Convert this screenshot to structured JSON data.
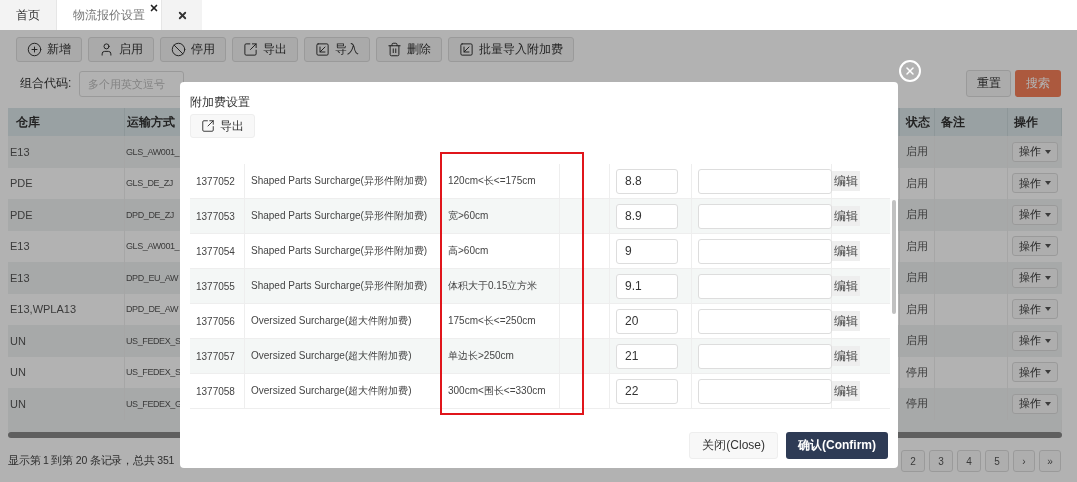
{
  "tabs": [
    {
      "label": "首页",
      "selected": false,
      "closable": false
    },
    {
      "label": "物流报价设置",
      "selected": true,
      "closable": true
    }
  ],
  "toolbar": [
    {
      "label": "新增",
      "kind": "add"
    },
    {
      "label": "启用",
      "kind": "enable"
    },
    {
      "label": "停用",
      "kind": "disable"
    },
    {
      "label": "导出",
      "kind": "export"
    },
    {
      "label": "导入",
      "kind": "import"
    },
    {
      "label": "删除",
      "kind": "delete"
    },
    {
      "label": "批量导入附加费",
      "kind": "import"
    }
  ],
  "filter": {
    "label": "组合代码:",
    "placeholder": "多个用英文逗号"
  },
  "reset_button": "重置",
  "search_button": "搜索",
  "table": {
    "columns": [
      "仓库",
      "运输方式",
      "状态",
      "备注",
      "操作"
    ],
    "rows": [
      {
        "warehouse": "E13",
        "shipping": "GLS_AW001_",
        "status": "启用",
        "action": "操作"
      },
      {
        "warehouse": "PDE",
        "shipping": "GLS_DE_ZJ",
        "status": "启用",
        "action": "操作"
      },
      {
        "warehouse": "PDE",
        "shipping": "DPD_DE_ZJ",
        "status": "启用",
        "action": "操作"
      },
      {
        "warehouse": "E13",
        "shipping": "GLS_AW001_",
        "status": "启用",
        "action": "操作"
      },
      {
        "warehouse": "E13",
        "shipping": "DPD_EU_AW",
        "status": "启用",
        "action": "操作"
      },
      {
        "warehouse": "E13,WPLA13",
        "shipping": "DPD_DE_AW",
        "status": "启用",
        "action": "操作"
      },
      {
        "warehouse": "UN",
        "shipping": "US_FEDEX_S",
        "status": "启用",
        "action": "操作"
      },
      {
        "warehouse": "UN",
        "shipping": "US_FEDEX_S",
        "status": "停用",
        "action": "操作"
      },
      {
        "warehouse": "UN",
        "shipping": "US_FEDEX_G",
        "status": "停用",
        "action": "操作"
      }
    ]
  },
  "pagination": {
    "summary": "显示第 1 到第 20 条记录，总共 351",
    "pages": [
      "2",
      "3",
      "4",
      "5",
      "›",
      "»"
    ]
  },
  "dialog": {
    "title": "附加费设置",
    "export_button": "导出",
    "rows": [
      {
        "id": "1377052",
        "name": "Shaped Parts Surcharge(异形件附加费)",
        "condition": "120cm<长<=175cm",
        "value": "8.8",
        "edit": "编辑"
      },
      {
        "id": "1377053",
        "name": "Shaped Parts Surcharge(异形件附加费)",
        "condition": "宽>60cm",
        "value": "8.9",
        "edit": "编辑"
      },
      {
        "id": "1377054",
        "name": "Shaped Parts Surcharge(异形件附加费)",
        "condition": "高>60cm",
        "value": "9",
        "edit": "编辑"
      },
      {
        "id": "1377055",
        "name": "Shaped Parts Surcharge(异形件附加费)",
        "condition": "体积大于0.15立方米",
        "value": "9.1",
        "edit": "编辑"
      },
      {
        "id": "1377056",
        "name": "Oversized Surcharge(超大件附加费)",
        "condition": "175cm<长<=250cm",
        "value": "20",
        "edit": "编辑"
      },
      {
        "id": "1377057",
        "name": "Oversized Surcharge(超大件附加费)",
        "condition": "单边长>250cm",
        "value": "21",
        "edit": "编辑"
      },
      {
        "id": "1377058",
        "name": "Oversized Surcharge(超大件附加费)",
        "condition": "300cm<围长<=330cm",
        "value": "22",
        "edit": "编辑"
      }
    ],
    "close_button": "关闭(Close)",
    "confirm_button": "确认(Confirm)"
  }
}
